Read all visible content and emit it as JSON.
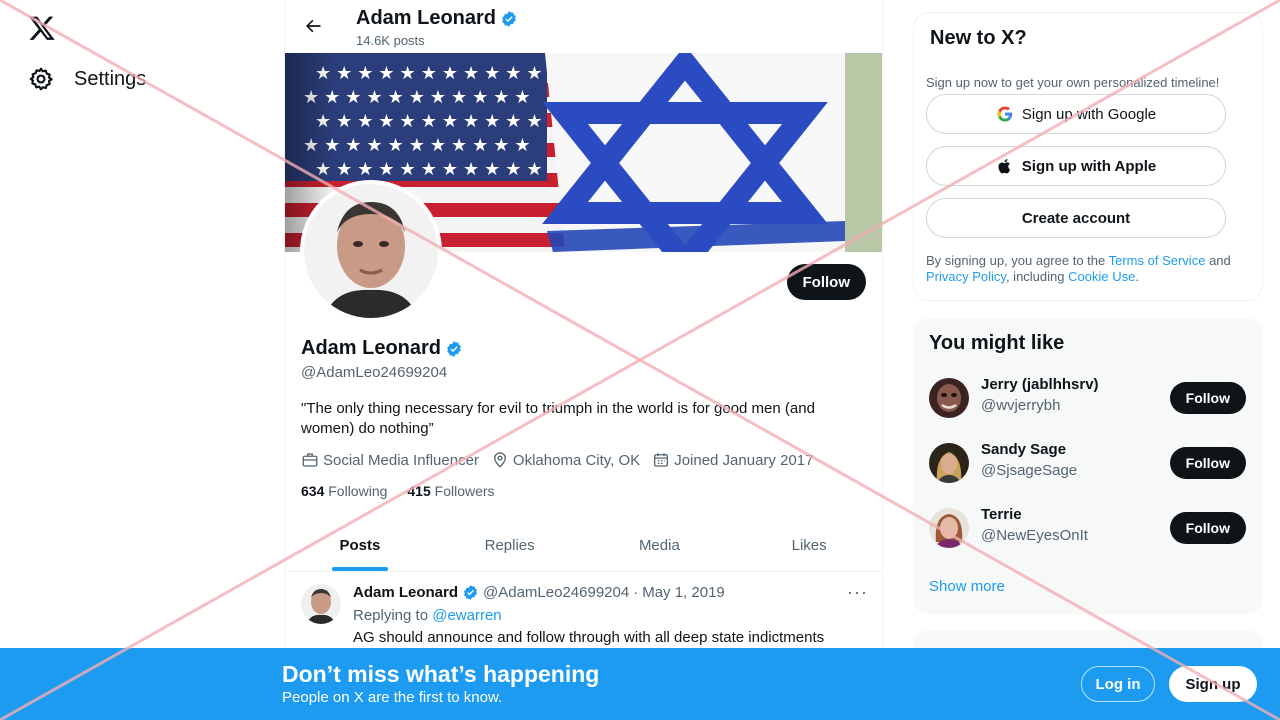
{
  "nav": {
    "settings_label": "Settings"
  },
  "header": {
    "name": "Adam Leonard",
    "posts": "14.6K posts"
  },
  "profile": {
    "follow_label": "Follow",
    "name": "Adam Leonard",
    "handle": "@AdamLeo24699204",
    "bio": "\"The only thing necessary for evil to triumph in the world is for good men (and women) do nothing”",
    "profession": "Social Media Influencer",
    "location": "Oklahoma City, OK",
    "joined": "Joined January 2017",
    "following_count": "634",
    "following_label": "Following",
    "followers_count": "415",
    "followers_label": "Followers"
  },
  "tabs": [
    {
      "label": "Posts"
    },
    {
      "label": "Replies"
    },
    {
      "label": "Media"
    },
    {
      "label": "Likes"
    }
  ],
  "tweet": {
    "name": "Adam Leonard",
    "handle": "@AdamLeo24699204",
    "separator": "·",
    "date": "May 1, 2019",
    "more": "···",
    "replying_prefix": "Replying to",
    "replying_to": "@ewarren",
    "text": "AG should announce and follow through with all deep state indictments"
  },
  "signup_card": {
    "title": "New to X?",
    "subtitle": "Sign up now to get your own personalized timeline!",
    "google_label": "Sign up with Google",
    "apple_label": "Sign up with Apple",
    "create_label": "Create account",
    "terms_prefix": "By signing up, you agree to the",
    "terms_link": "Terms of Service",
    "terms_and": "and",
    "privacy_link": "Privacy Policy",
    "terms_including": ", including",
    "cookie_link": "Cookie Use",
    "terms_end": "."
  },
  "suggestions": {
    "title": "You might like",
    "items": [
      {
        "name": "Jerry (jablhhsrv)",
        "handle": "@wvjerrybh",
        "follow": "Follow"
      },
      {
        "name": "Sandy Sage",
        "handle": "@SjsageSage",
        "follow": "Follow"
      },
      {
        "name": "Terrie",
        "handle": "@NewEyesOnIt",
        "follow": "Follow"
      }
    ],
    "show_more": "Show more"
  },
  "bottom_bar": {
    "title": "Don’t miss what’s happening",
    "subtitle": "People on X are the first to know.",
    "login": "Log in",
    "signup": "Sign up"
  },
  "colors": {
    "accent": "#1d9bf0",
    "text": "#0f1419",
    "secondary": "#536471",
    "overlay_x": "#f2aeb3"
  }
}
